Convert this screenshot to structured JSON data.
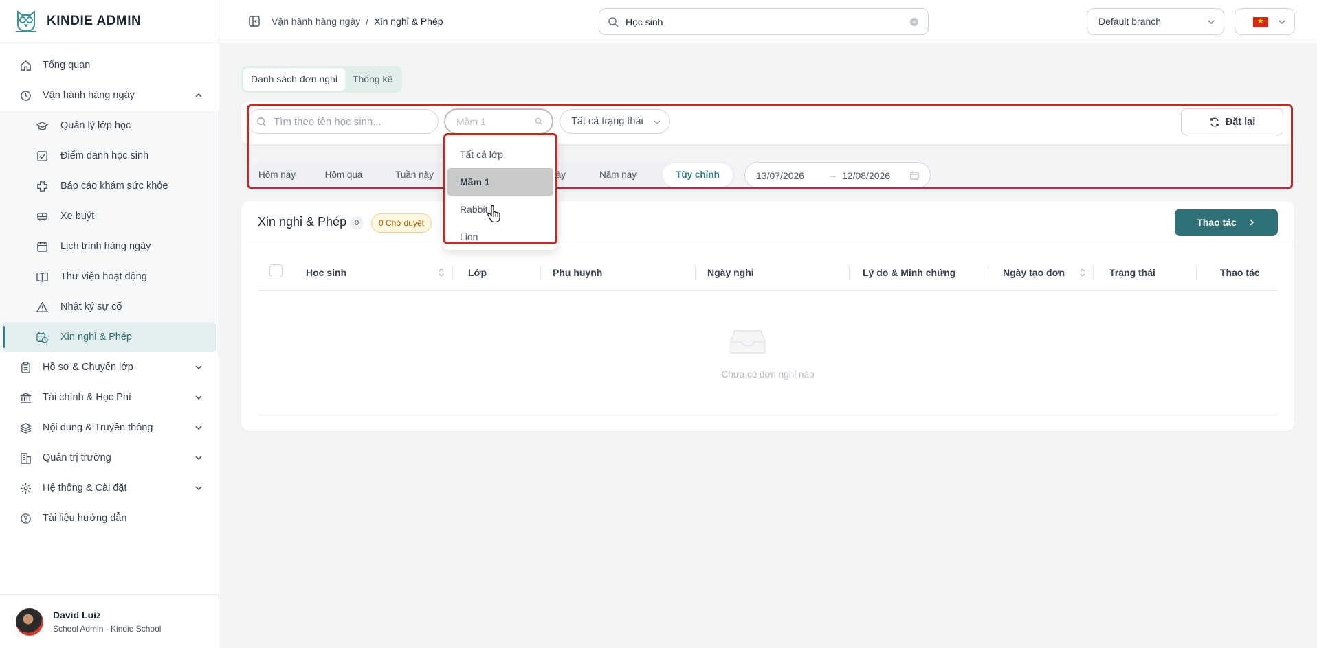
{
  "brand": {
    "name": "KINDIE ADMIN"
  },
  "sidebar": {
    "items": [
      {
        "label": "Tổng quan",
        "icon": "home-icon"
      },
      {
        "label": "Vận hành hàng ngày",
        "icon": "clock-icon",
        "expanded": true
      },
      {
        "label": "Hồ sơ & Chuyển lớp",
        "icon": "clipboard-icon"
      },
      {
        "label": "Tài chính & Học Phí",
        "icon": "bank-icon"
      },
      {
        "label": "Nội dung & Truyền thông",
        "icon": "layers-icon"
      },
      {
        "label": "Quản trị trường",
        "icon": "building-icon"
      },
      {
        "label": "Hệ thống & Cài đặt",
        "icon": "gear-icon"
      },
      {
        "label": "Tài liệu hướng dẫn",
        "icon": "help-icon"
      }
    ],
    "subitems": [
      {
        "label": "Quản lý lớp học",
        "icon": "graduation-cap-icon"
      },
      {
        "label": "Điểm danh học sinh",
        "icon": "check-square-icon"
      },
      {
        "label": "Báo cáo khám sức khỏe",
        "icon": "health-cross-icon"
      },
      {
        "label": "Xe buýt",
        "icon": "bus-icon"
      },
      {
        "label": "Lịch trình hàng ngày",
        "icon": "calendar-icon"
      },
      {
        "label": "Thư viện hoạt động",
        "icon": "book-icon"
      },
      {
        "label": "Nhật ký sự cố",
        "icon": "warning-icon"
      },
      {
        "label": "Xin nghỉ & Phép",
        "icon": "calendar-clock-icon",
        "active": true
      }
    ]
  },
  "user": {
    "name": "David Luiz",
    "role": "School Admin · Kindie School"
  },
  "header": {
    "breadcrumb_parent": "Vận hành hàng ngày",
    "breadcrumb_sep": "/",
    "breadcrumb_current": "Xin nghỉ & Phép",
    "search_value": "Học sinh",
    "branch": "Default branch",
    "language": "vi"
  },
  "tabs": [
    {
      "label": "Danh sách đơn nghỉ",
      "active": true
    },
    {
      "label": "Thống kê",
      "active": false
    }
  ],
  "filters": {
    "student_placeholder": "Tìm theo tên học sinh...",
    "class_placeholder": "Mầm 1",
    "status": "Tất cả trạng thái",
    "reset_label": "Đặt lại"
  },
  "presets": [
    {
      "label": "Hôm nay"
    },
    {
      "label": "Hôm qua"
    },
    {
      "label": "Tuần này"
    },
    {
      "label": "Tháng này"
    },
    {
      "label": "Năm nay"
    },
    {
      "label": "Tùy chỉnh",
      "active": true
    }
  ],
  "date_range": {
    "from": "13/07/2026",
    "arrow": "→",
    "to": "12/08/2026"
  },
  "class_dropdown": {
    "options": [
      {
        "label": "Tất cả lớp"
      },
      {
        "label": "Mầm 1",
        "selected": true
      },
      {
        "label": "Rabbit"
      },
      {
        "label": "Lion"
      }
    ]
  },
  "card": {
    "title": "Xin nghỉ & Phép",
    "count": "0",
    "pending": "0 Chờ duyệt",
    "action_label": "Thao tác",
    "columns": [
      "Học sinh",
      "Lớp",
      "Phụ huynh",
      "Ngày nghỉ",
      "Lý do & Minh chứng",
      "Ngày tạo đơn",
      "Trạng thái",
      "Thao tác"
    ],
    "empty_text": "Chưa có đơn nghỉ nào"
  },
  "colors": {
    "accent": "#2f7177",
    "highlight": "#c62828"
  }
}
